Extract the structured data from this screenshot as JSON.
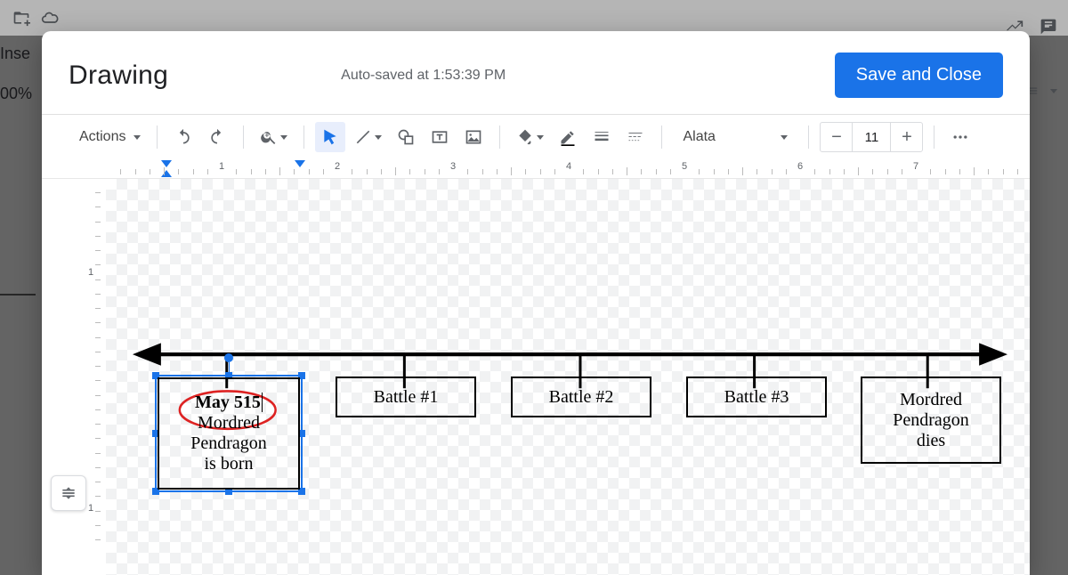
{
  "bg": {
    "menu_insert": "Inse",
    "zoom": "00%"
  },
  "dialog": {
    "title": "Drawing",
    "status": "Auto-saved at 1:53:39 PM",
    "save_label": "Save and Close"
  },
  "toolbar": {
    "actions_label": "Actions",
    "font_name": "Alata",
    "font_size": "11",
    "icons": {
      "undo": "undo-icon",
      "redo": "redo-icon",
      "zoom": "zoom-icon",
      "select": "select-icon",
      "line": "line-icon",
      "shape": "shape-icon",
      "textbox": "textbox-icon",
      "image": "image-icon",
      "fill": "fill-color-icon",
      "border_color": "border-color-icon",
      "border_weight": "border-weight-icon",
      "border_dash": "border-dash-icon",
      "more": "more-icon"
    }
  },
  "ruler": {
    "h_marks": [
      "1",
      "2",
      "3",
      "4",
      "5",
      "6",
      "7"
    ],
    "v_marks": [
      "1",
      "1"
    ]
  },
  "timeline": {
    "box1": {
      "title": "May 515",
      "line1": "Mordred",
      "line2": "Pendragon",
      "line3": "is born"
    },
    "box2": {
      "label": "Battle #1"
    },
    "box3": {
      "label": "Battle #2"
    },
    "box4": {
      "label": "Battle #3"
    },
    "box5": {
      "line1": "Mordred",
      "line2": "Pendragon",
      "line3": "dies"
    }
  }
}
